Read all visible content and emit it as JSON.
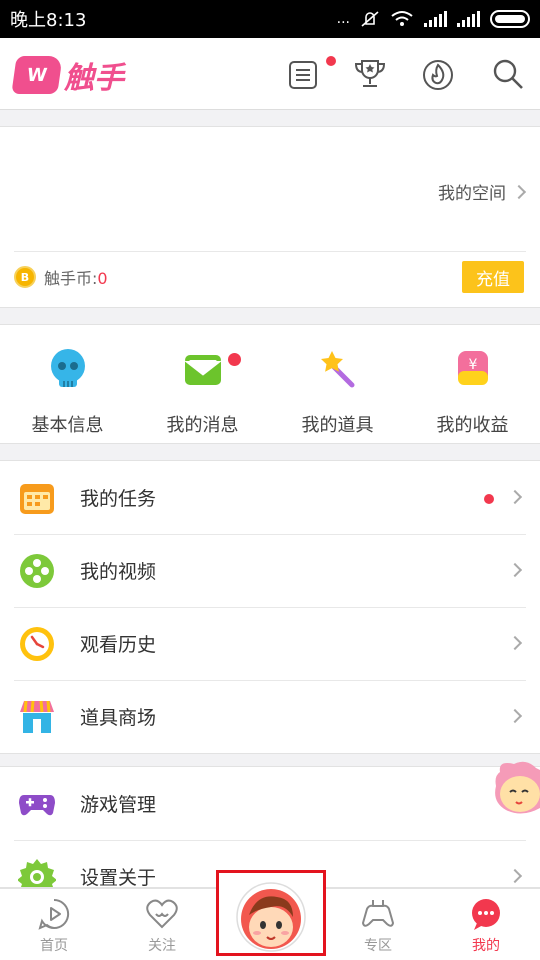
{
  "status_bar": {
    "time": "晚上8:13",
    "dots": "..."
  },
  "brand": {
    "logo_mark": "W",
    "name": "触手",
    "color": "#f04f8e"
  },
  "header": {
    "icons": [
      "news-icon",
      "trophy-icon",
      "fire-icon",
      "search-icon"
    ]
  },
  "profile": {
    "space_label": "我的空间",
    "coin_label": "触手币:",
    "coin_value": "0",
    "coin_symbol": "B",
    "recharge_label": "充值"
  },
  "quick_actions": [
    {
      "label": "基本信息",
      "icon": "skull-icon"
    },
    {
      "label": "我的消息",
      "icon": "envelope-icon",
      "badge": true
    },
    {
      "label": "我的道具",
      "icon": "magic-wand-icon"
    },
    {
      "label": "我的收益",
      "icon": "money-bag-icon"
    }
  ],
  "menu_group_1": [
    {
      "label": "我的任务",
      "icon": "calendar-icon",
      "badge": true
    },
    {
      "label": "我的视频",
      "icon": "film-reel-icon"
    },
    {
      "label": "观看历史",
      "icon": "clock-icon"
    },
    {
      "label": "道具商场",
      "icon": "shop-icon"
    }
  ],
  "menu_group_2": [
    {
      "label": "游戏管理",
      "icon": "gamepad-icon"
    },
    {
      "label": "设置关于",
      "icon": "settings-icon"
    }
  ],
  "tabs": [
    {
      "label": "首页",
      "icon": "play-icon"
    },
    {
      "label": "关注",
      "icon": "heart-icon"
    },
    {
      "label": "专区",
      "icon": "controller-icon"
    },
    {
      "label": "我的",
      "icon": "chat-bubble-icon",
      "active": true
    }
  ],
  "colors": {
    "accent": "#f2384e",
    "coin": "#fcc31b",
    "highlight_box": "#e3131e"
  }
}
